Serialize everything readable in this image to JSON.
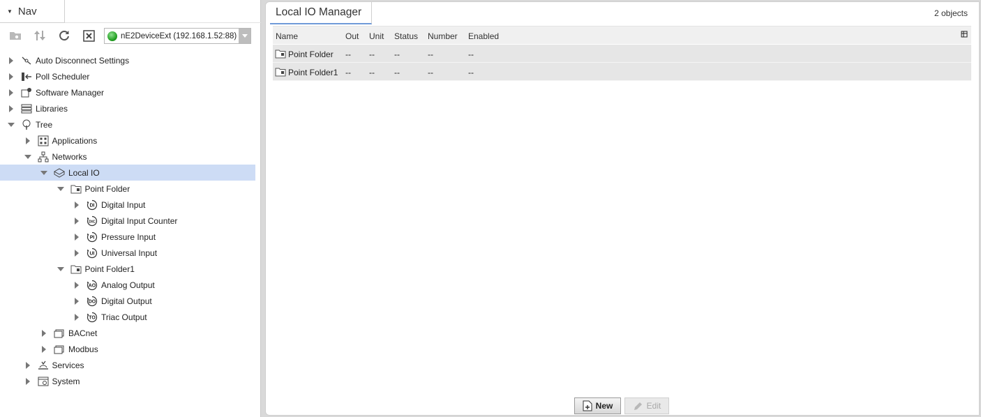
{
  "nav": {
    "title": "Nav",
    "station": "nE2DeviceExt (192.168.1.52:88)",
    "tree": [
      {
        "label": "Auto Disconnect Settings",
        "depth": 0,
        "state": "collapsed",
        "icon": "disconnect-icon"
      },
      {
        "label": "Poll Scheduler",
        "depth": 0,
        "state": "collapsed",
        "icon": "poll-scheduler-icon"
      },
      {
        "label": "Software Manager",
        "depth": 0,
        "state": "collapsed",
        "icon": "software-manager-icon"
      },
      {
        "label": "Libraries",
        "depth": 0,
        "state": "collapsed",
        "icon": "libraries-icon"
      },
      {
        "label": "Tree",
        "depth": 0,
        "state": "expanded",
        "icon": "tree-icon"
      },
      {
        "label": "Applications",
        "depth": 1,
        "state": "collapsed",
        "icon": "applications-icon"
      },
      {
        "label": "Networks",
        "depth": 1,
        "state": "expanded",
        "icon": "networks-icon"
      },
      {
        "label": "Local IO",
        "depth": 2,
        "state": "expanded",
        "icon": "local-io-icon",
        "selected": true
      },
      {
        "label": "Point Folder",
        "depth": 3,
        "state": "expanded",
        "icon": "folder-icon"
      },
      {
        "label": "Digital Input",
        "depth": 4,
        "state": "collapsed",
        "icon": "point-di-icon",
        "badge": "DI"
      },
      {
        "label": "Digital Input Counter",
        "depth": 4,
        "state": "collapsed",
        "icon": "point-dic-icon",
        "badge": "DIC"
      },
      {
        "label": "Pressure Input",
        "depth": 4,
        "state": "collapsed",
        "icon": "point-pi-icon",
        "badge": "PI"
      },
      {
        "label": "Universal Input",
        "depth": 4,
        "state": "collapsed",
        "icon": "point-ui-icon",
        "badge": "UI"
      },
      {
        "label": "Point Folder1",
        "depth": 3,
        "state": "expanded",
        "icon": "folder-icon"
      },
      {
        "label": "Analog Output",
        "depth": 4,
        "state": "collapsed",
        "icon": "point-ao-icon",
        "badge": "AO"
      },
      {
        "label": "Digital Output",
        "depth": 4,
        "state": "collapsed",
        "icon": "point-do-icon",
        "badge": "DO"
      },
      {
        "label": "Triac Output",
        "depth": 4,
        "state": "collapsed",
        "icon": "point-to-icon",
        "badge": "TO"
      },
      {
        "label": "BACnet",
        "depth": 2,
        "state": "collapsed",
        "icon": "network-stack-icon"
      },
      {
        "label": "Modbus",
        "depth": 2,
        "state": "collapsed",
        "icon": "network-stack-icon"
      },
      {
        "label": "Services",
        "depth": 1,
        "state": "collapsed",
        "icon": "services-icon"
      },
      {
        "label": "System",
        "depth": 1,
        "state": "collapsed",
        "icon": "system-icon"
      }
    ]
  },
  "manager": {
    "title": "Local IO Manager",
    "object_count": "2 objects",
    "columns": [
      "Name",
      "Out",
      "Unit",
      "Status",
      "Number",
      "Enabled"
    ],
    "rows": [
      {
        "name": "Point Folder",
        "out": "--",
        "unit": "--",
        "status": "--",
        "number": "--",
        "enabled": "--"
      },
      {
        "name": "Point Folder1",
        "out": "--",
        "unit": "--",
        "status": "--",
        "number": "--",
        "enabled": "--"
      }
    ],
    "new_label": "New",
    "edit_label": "Edit"
  },
  "colors": {
    "selection": "#cddcf5",
    "accent": "#6f9ad8",
    "status_ok": "#1f9d1f"
  }
}
